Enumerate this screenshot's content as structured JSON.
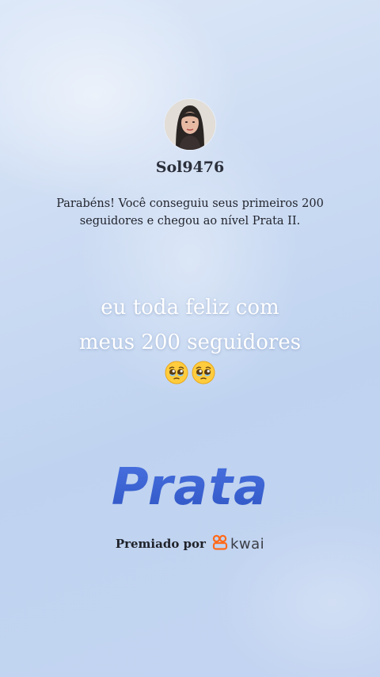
{
  "profile": {
    "username": "Sol9476"
  },
  "message": {
    "line1": "Parabéns! Você conseguiu seus primeiros 200",
    "line2": "seguidores e chegou ao nível Prata II."
  },
  "caption": {
    "line1": "eu toda feliz com",
    "line2": "meus 200 seguidores"
  },
  "emojis": [
    "pleading-face-icon",
    "pleading-face-icon"
  ],
  "tier": {
    "name": "Prata",
    "color": "#3d66d6"
  },
  "awarded": {
    "label": "Premiado por",
    "brand": "kwai",
    "brand_icon": "kwai-logo-icon",
    "brand_color": "#ff6a1a"
  }
}
